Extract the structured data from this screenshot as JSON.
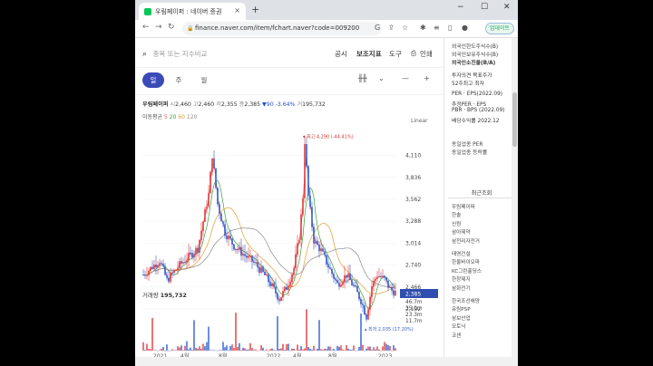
{
  "browser": {
    "tab_title": "우림페이퍼 : 네이버 증권",
    "url": "finance.naver.com/item/fchart.naver?code=009200",
    "update_label": "업데이트",
    "tab_close": "×",
    "new_tab": "+",
    "win_min": "−",
    "win_max": "☐",
    "win_close": "✕"
  },
  "header": {
    "search_placeholder": "종목 또는 지수비교",
    "menu": [
      "공시",
      "보조지표",
      "도구",
      "인쇄"
    ],
    "periods": [
      "일",
      "주",
      "월"
    ],
    "active_period": "일"
  },
  "quote": {
    "name": "우림페이퍼",
    "open_label": "시",
    "open": "2,460",
    "high_label": "고",
    "high": "2,460",
    "low_label": "저",
    "low": "2,355",
    "close_label": "종",
    "close": "2,385",
    "change": "▼90",
    "change_pct": "-3.64%",
    "volume_label": "거",
    "volume": "195,732"
  },
  "moving_avg": {
    "label": "이동평균",
    "p5": "5",
    "p20": "20",
    "p60": "60",
    "p120": "120"
  },
  "scale_mode": "Linear",
  "volume_panel": {
    "label": "거래량",
    "value": "195,732"
  },
  "chart_data": {
    "type": "candlestick",
    "y_ticks": [
      "4,110",
      "3,836",
      "3,562",
      "3,288",
      "3,014",
      "2,740",
      "2,466",
      "2,192"
    ],
    "y_range": [
      2000,
      4400
    ],
    "current_price_label": "2,385",
    "high_annotation": "최고 4,290 (-44.41%)",
    "low_annotation": "최저 2,035 (17.20%)",
    "x_ticks": [
      "2021",
      "4월",
      "8월",
      "2022",
      "4월",
      "8월",
      "2023"
    ],
    "volume_ticks": [
      "46.7m",
      "35.0m",
      "23.3m",
      "11.7m"
    ],
    "series": [
      {
        "name": "5",
        "color": "#e1536b"
      },
      {
        "name": "20",
        "color": "#3a9d3a"
      },
      {
        "name": "60",
        "color": "#e39b2c"
      },
      {
        "name": "120",
        "color": "#8a8a8a"
      }
    ]
  },
  "side": {
    "top_items": [
      "외국인한도주식수(B)",
      "외국인보유주식수(B)",
      "외국인소진율(B/A)",
      "투자의견  목표주가",
      "52주최고  최저",
      "PER · EPS(2022.09)",
      "추정PER · EPS",
      "PBR · BPS (2022.09)",
      "배당수익률  2022.12"
    ],
    "industry_items": [
      "동일업종 PER",
      "동일업종 등락률"
    ],
    "recent_head": "최근조회",
    "recent": [
      "우림페이퍼",
      "한솔",
      "신원",
      "삼아제약",
      "삼천리자전거",
      "",
      "태영건설",
      "한울바이오파",
      "KC그린홀딩스",
      "한창제지",
      "삼화전기",
      "",
      "한국조선해양",
      "유림PSP",
      "삼보산업",
      "모토닉",
      "코센"
    ]
  }
}
